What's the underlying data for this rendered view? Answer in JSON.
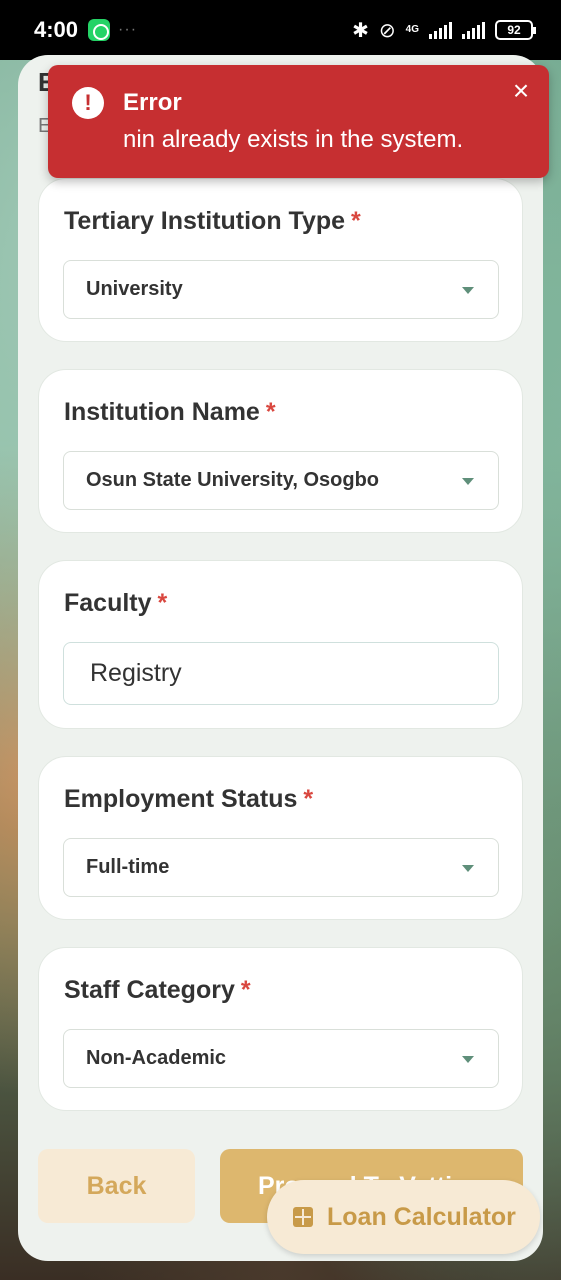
{
  "status_bar": {
    "time": "4:00",
    "network": "4G",
    "battery": "92"
  },
  "page": {
    "title_partial": "E",
    "subtitle_partial": "E"
  },
  "toast": {
    "title": "Error",
    "message": "nin already exists in the system.",
    "icon": "!",
    "close": "×",
    "color": "#c62f31"
  },
  "form": {
    "institution_type": {
      "label": "Tertiary Institution Type",
      "required": "*",
      "value": "University"
    },
    "institution_name": {
      "label": "Institution Name",
      "required": "*",
      "value": "Osun State University, Osogbo"
    },
    "faculty": {
      "label": "Faculty",
      "required": "*",
      "value": "Registry"
    },
    "employment_status": {
      "label": "Employment Status",
      "required": "*",
      "value": "Full-time"
    },
    "staff_category": {
      "label": "Staff Category",
      "required": "*",
      "value": "Non-Academic"
    }
  },
  "actions": {
    "back_label": "Back",
    "proceed_label": "Proceed To Vetting",
    "calculator_label": "Loan Calculator"
  },
  "colors": {
    "accent": "#ddb76e",
    "required": "#d9473f",
    "error": "#c62f31"
  }
}
